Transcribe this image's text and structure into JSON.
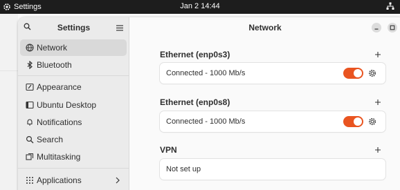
{
  "topbar": {
    "app_name": "Settings",
    "clock": "Jan 2  14:44"
  },
  "sidebar": {
    "title": "Settings",
    "items": [
      {
        "label": "Network",
        "icon": "network-icon",
        "active": true
      },
      {
        "label": "Bluetooth",
        "icon": "bluetooth-icon",
        "active": false
      },
      {
        "label": "Appearance",
        "icon": "appearance-icon",
        "active": false
      },
      {
        "label": "Ubuntu Desktop",
        "icon": "ubuntu-desktop-icon",
        "active": false
      },
      {
        "label": "Notifications",
        "icon": "bell-icon",
        "active": false
      },
      {
        "label": "Search",
        "icon": "search-icon",
        "active": false
      },
      {
        "label": "Multitasking",
        "icon": "multitasking-icon",
        "active": false
      },
      {
        "label": "Applications",
        "icon": "apps-grid-icon",
        "active": false,
        "has_submenu": true
      }
    ]
  },
  "main": {
    "title": "Network",
    "sections": [
      {
        "title": "Ethernet (enp0s3)",
        "status": "Connected - 1000 Mb/s",
        "enabled": true
      },
      {
        "title": "Ethernet (enp0s8)",
        "status": "Connected - 1000 Mb/s",
        "enabled": true
      },
      {
        "title": "VPN",
        "status": "Not set up"
      }
    ]
  },
  "colors": {
    "accent": "#e95420",
    "topbar": "#1d1d1d",
    "sidebar": "#ebebeb",
    "selected": "#d9d9d9"
  }
}
